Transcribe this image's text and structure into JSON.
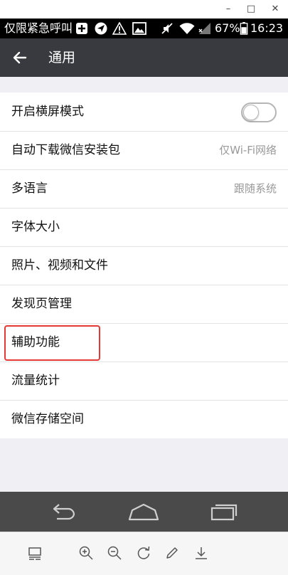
{
  "window": {
    "minimize_glyph": "–",
    "maximize_glyph": "□",
    "close_glyph": "✕"
  },
  "status_bar": {
    "carrier": "仅限紧急呼叫",
    "battery": "67%",
    "time": "16:23"
  },
  "app_bar": {
    "title": "通用"
  },
  "settings": [
    {
      "label": "开启横屏模式",
      "value": "",
      "control": "toggle",
      "toggle_on": false
    },
    {
      "label": "自动下载微信安装包",
      "value": "仅Wi-Fi网络"
    },
    {
      "label": "多语言",
      "value": "跟随系统"
    },
    {
      "label": "字体大小",
      "value": ""
    },
    {
      "label": "照片、视频和文件",
      "value": ""
    },
    {
      "label": "发现页管理",
      "value": ""
    },
    {
      "label": "辅助功能",
      "value": "",
      "highlighted": true
    },
    {
      "label": "流量统计",
      "value": ""
    },
    {
      "label": "微信存储空间",
      "value": ""
    }
  ],
  "colors": {
    "app_bar": "#393a3f",
    "background": "#efeff4",
    "highlight": "#e53935",
    "nav_bar": "#4a4a4a"
  }
}
